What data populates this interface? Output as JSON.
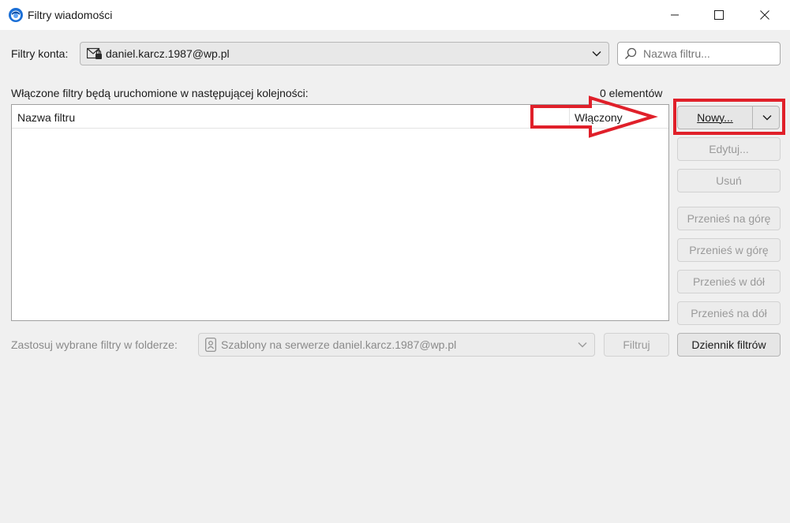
{
  "window": {
    "title": "Filtry wiadomości",
    "controls": [
      "minimize-icon",
      "maximize-icon",
      "close-icon"
    ]
  },
  "account": {
    "label": "Filtry konta:",
    "value": "daniel.karcz.1987@wp.pl",
    "icon": "mail-account-icon"
  },
  "search": {
    "placeholder": "Nazwa filtru..."
  },
  "list": {
    "order_label": "Włączone filtry będą uruchomione w następującej kolejności:",
    "count": "0 elementów",
    "columns": [
      "Nazwa filtru",
      "Włączony"
    ],
    "rows": []
  },
  "buttons": {
    "new": "Nowy...",
    "edit": "Edytuj...",
    "delete": "Usuń",
    "move_top": "Przenieś na górę",
    "move_up": "Przenieś w górę",
    "move_down": "Przenieś w dół",
    "move_bottom": "Przenieś na dół",
    "run": "Filtruj",
    "log": "Dziennik filtrów"
  },
  "apply": {
    "label": "Zastosuj wybrane filtry w folderze:",
    "folder": "Szablony na serwerze daniel.karcz.1987@wp.pl"
  },
  "colors": {
    "annotation": "#e0202a",
    "background": "#f0f0f0",
    "accent": "#1b6fd6"
  }
}
